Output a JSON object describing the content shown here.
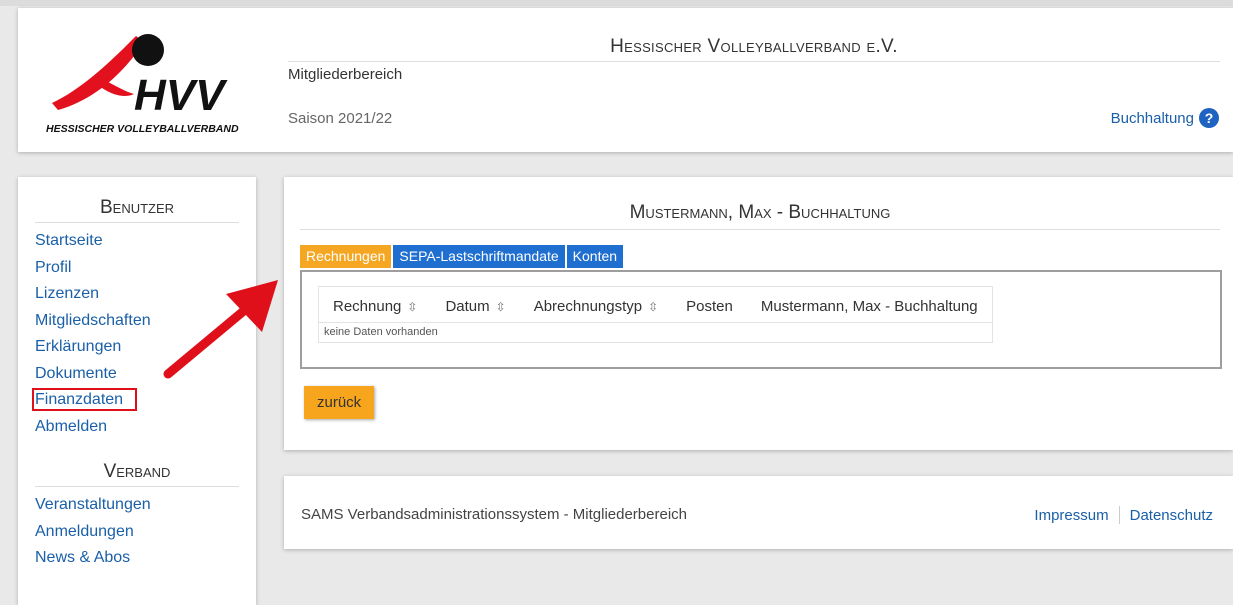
{
  "header": {
    "org_title": "Hessischer Volleyballverband e.V.",
    "subtitle": "Mitgliederbereich",
    "season": "Saison 2021/22",
    "help_link": "Buchhaltung",
    "help_icon_glyph": "?",
    "logo": {
      "letters": "HVV",
      "tagline": "HESSISCHER VOLLEYBALLVERBAND"
    }
  },
  "sidebar": {
    "user_heading": "Benutzer",
    "user_items": [
      {
        "label": "Startseite"
      },
      {
        "label": "Profil"
      },
      {
        "label": "Lizenzen"
      },
      {
        "label": "Mitgliedschaften"
      },
      {
        "label": "Erklärungen"
      },
      {
        "label": "Dokumente"
      },
      {
        "label": "Finanzdaten"
      },
      {
        "label": "Abmelden"
      }
    ],
    "association_heading": "Verband",
    "association_items": [
      {
        "label": "Veranstaltungen"
      },
      {
        "label": "Anmeldungen"
      },
      {
        "label": "News & Abos"
      }
    ]
  },
  "main": {
    "title": "Mustermann, Max - Buchhaltung",
    "tabs": [
      {
        "label": "Rechnungen",
        "active": true
      },
      {
        "label": "SEPA-Lastschriftmandate",
        "active": false
      },
      {
        "label": "Konten",
        "active": false
      }
    ],
    "table": {
      "columns": [
        {
          "label": "Rechnung",
          "sortable": true
        },
        {
          "label": "Datum",
          "sortable": true
        },
        {
          "label": "Abrechnungstyp",
          "sortable": true
        },
        {
          "label": "Posten",
          "sortable": false
        },
        {
          "label": "Mustermann, Max - Buchhaltung",
          "sortable": false
        }
      ],
      "empty_message": "keine Daten vorhanden"
    },
    "back_button": "zurück"
  },
  "footer": {
    "text": "SAMS Verbandsadministrationssystem - Mitgliederbereich",
    "links": [
      "Impressum",
      "Datenschutz"
    ]
  },
  "colors": {
    "link": "#1a5fa8",
    "tab_active": "#f5a623",
    "tab_inactive": "#1f6fd0",
    "button": "#f7a51c",
    "annotation_red": "#e0101a",
    "logo_red": "#e3101d"
  }
}
